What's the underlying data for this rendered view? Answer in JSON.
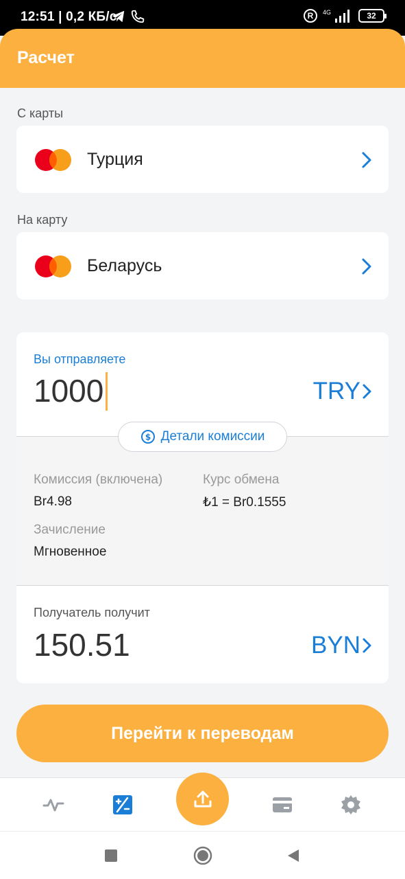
{
  "status_bar": {
    "time": "12:51",
    "speed": "| 0,2 КБ/с",
    "network": "4G",
    "battery": "32",
    "r_badge": "R"
  },
  "header": {
    "title": "Расчет"
  },
  "from_card": {
    "label": "С карты",
    "country": "Турция",
    "card_icon": "mastercard-icon"
  },
  "to_card": {
    "label": "На карту",
    "country": "Беларусь",
    "card_icon": "mastercard-icon"
  },
  "calculator": {
    "send_label": "Вы отправляете",
    "send_amount": "1000",
    "send_currency": "TRY",
    "details_button": "Детали комиссии",
    "commission_label": "Комиссия (включена)",
    "commission_value": "Br4.98",
    "rate_label": "Курс обмена",
    "rate_value": "₺1 = Br0.1555",
    "credit_label": "Зачисление",
    "credit_value": "Мгновенное",
    "receive_label": "Получатель получит",
    "receive_amount": "150.51",
    "receive_currency": "BYN"
  },
  "actions": {
    "go_button": "Перейти к переводам"
  },
  "bottom_nav": {
    "items": [
      {
        "icon": "activity-icon",
        "active": false
      },
      {
        "icon": "calculator-icon",
        "active": true
      },
      {
        "icon": "upload-icon",
        "active": false
      },
      {
        "icon": "card-icon",
        "active": false
      },
      {
        "icon": "gear-icon",
        "active": false
      }
    ]
  },
  "colors": {
    "accent": "#fbb040",
    "link_blue": "#1a7ed6",
    "mastercard_red": "#eb001b",
    "mastercard_orange": "#f79e1b"
  }
}
